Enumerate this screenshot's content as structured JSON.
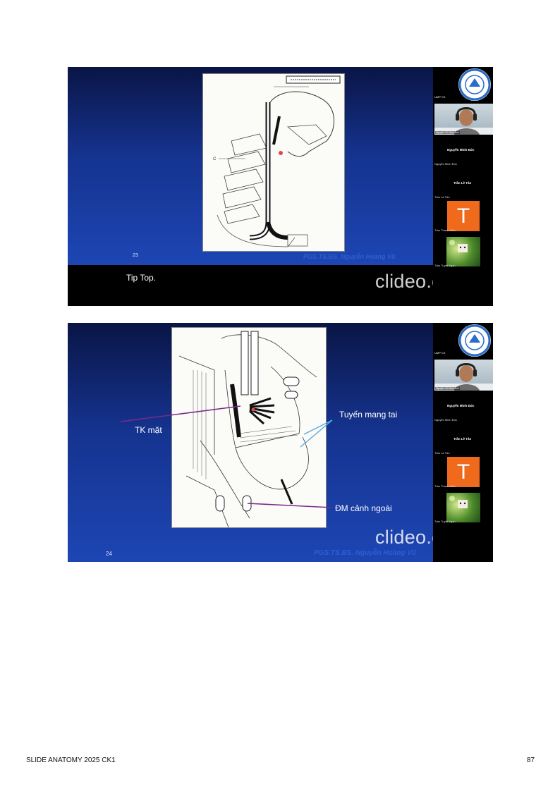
{
  "slides": [
    {
      "number": "23",
      "author": "PGS.TS.BS. Nguyễn Hoàng Vũ",
      "caption": "Tip Top.",
      "watermark": "clideo.com"
    },
    {
      "number": "24",
      "author": "PGS.TS.BS. Nguyễn Hoàng Vũ",
      "watermark": "clideo.com",
      "labels": {
        "facial_nerve": "TK mặt",
        "parotid": "Tuyến mang tai",
        "external_carotid": "ĐM cảnh ngoài"
      }
    }
  ],
  "participants": {
    "host_label": "UMP CK",
    "camera_label": "Nguyễn Tô Minh Ánh",
    "person1_name": "Nguyễn Minh Đức",
    "person1_sub": "Nguyễn Minh Đức",
    "person2_name": "Trần Lê Tân",
    "person2_sub": "Trần Lê Tân",
    "avatar_letter": "T",
    "person3_sub": "Trần Thanh Hiền",
    "person4_sub": "Trần Tuyết Ngân"
  },
  "footer": {
    "left": "SLIDE ANATOMY 2025 CK1",
    "right": "87"
  },
  "colors": {
    "slide_blue": "#1d46b4",
    "avatar_orange": "#f06a1d",
    "label_line": "#7a2a8a",
    "pointer_line": "#5aa9e0"
  }
}
